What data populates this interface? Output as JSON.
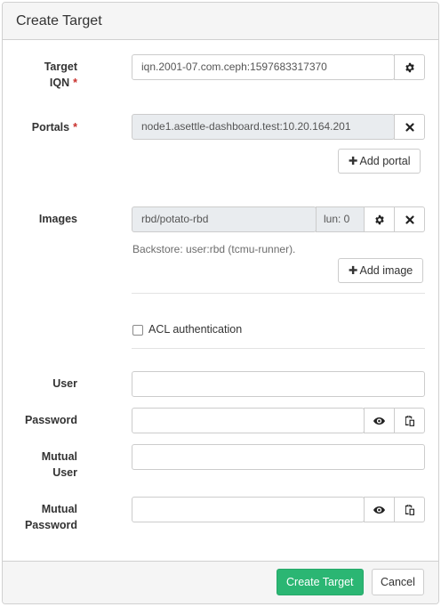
{
  "title": "Create Target",
  "target_iqn": {
    "label_line1": "Target",
    "label_line2": "IQN",
    "required_mark": "*",
    "value": "iqn.2001-07.com.ceph:1597683317370"
  },
  "portals": {
    "label": "Portals",
    "required_mark": "*",
    "value": "node1.asettle-dashboard.test:10.20.164.201",
    "add_label": "Add portal"
  },
  "images": {
    "label": "Images",
    "value": "rbd/potato-rbd",
    "lun": "lun: 0",
    "backstore": "Backstore: user:rbd (tcmu-runner).",
    "add_label": "Add image"
  },
  "acl": {
    "label": "ACL authentication",
    "checked": false
  },
  "user": {
    "label": "User",
    "value": ""
  },
  "password": {
    "label": "Password",
    "value": ""
  },
  "mutual_user": {
    "label_line1": "Mutual",
    "label_line2": "User",
    "value": ""
  },
  "mutual_password": {
    "label_line1": "Mutual",
    "label_line2": "Password",
    "value": ""
  },
  "footer": {
    "submit_label": "Create Target",
    "cancel_label": "Cancel",
    "submit_color": "#2bb673"
  },
  "icons": {
    "settings": "gear-icon",
    "remove": "close-icon",
    "reveal": "eye-icon",
    "copy": "clipboard-icon",
    "add": "plus-icon"
  }
}
